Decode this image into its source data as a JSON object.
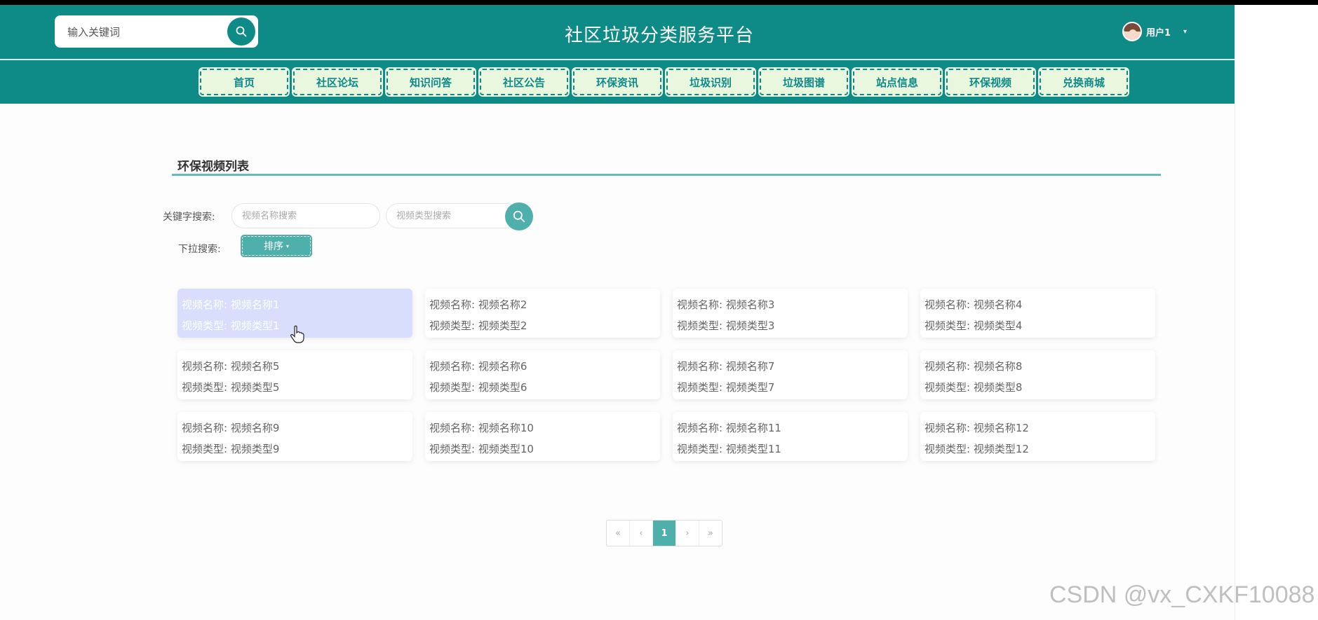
{
  "header": {
    "search_placeholder": "输入关键词",
    "title": "社区垃圾分类服务平台",
    "user_name": "用户1",
    "caret": "▾"
  },
  "nav": {
    "items": [
      "首页",
      "社区论坛",
      "知识问答",
      "社区公告",
      "环保资讯",
      "垃圾识别",
      "垃圾图谱",
      "站点信息",
      "环保视频",
      "兑换商城"
    ]
  },
  "main": {
    "section_title": "环保视频列表",
    "keyword_label": "关键字搜索:",
    "name_placeholder": "视频名称搜索",
    "type_placeholder": "视频类型搜索",
    "dropdown_label": "下拉搜索:",
    "sort_label": "排序",
    "sort_caret": "▾",
    "cards": [
      {
        "name": "视频名称: 视频名称1",
        "type": "视频类型: 视频类型1"
      },
      {
        "name": "视频名称: 视频名称2",
        "type": "视频类型: 视频类型2"
      },
      {
        "name": "视频名称: 视频名称3",
        "type": "视频类型: 视频类型3"
      },
      {
        "name": "视频名称: 视频名称4",
        "type": "视频类型: 视频类型4"
      },
      {
        "name": "视频名称: 视频名称5",
        "type": "视频类型: 视频类型5"
      },
      {
        "name": "视频名称: 视频名称6",
        "type": "视频类型: 视频类型6"
      },
      {
        "name": "视频名称: 视频名称7",
        "type": "视频类型: 视频类型7"
      },
      {
        "name": "视频名称: 视频名称8",
        "type": "视频类型: 视频类型8"
      },
      {
        "name": "视频名称: 视频名称9",
        "type": "视频类型: 视频类型9"
      },
      {
        "name": "视频名称: 视频名称10",
        "type": "视频类型: 视频类型10"
      },
      {
        "name": "视频名称: 视频名称11",
        "type": "视频类型: 视频类型11"
      },
      {
        "name": "视频名称: 视频名称12",
        "type": "视频类型: 视频类型12"
      }
    ]
  },
  "pagination": {
    "first": "«",
    "prev": "‹",
    "current": "1",
    "next": "›",
    "last": "»"
  },
  "watermark": "CSDN @vx_CXKF10088",
  "colors": {
    "primary": "#0e8a87",
    "accent": "#4fb0ab",
    "nav_button_bg": "#e9f7df",
    "active_card": "#d8defb"
  }
}
